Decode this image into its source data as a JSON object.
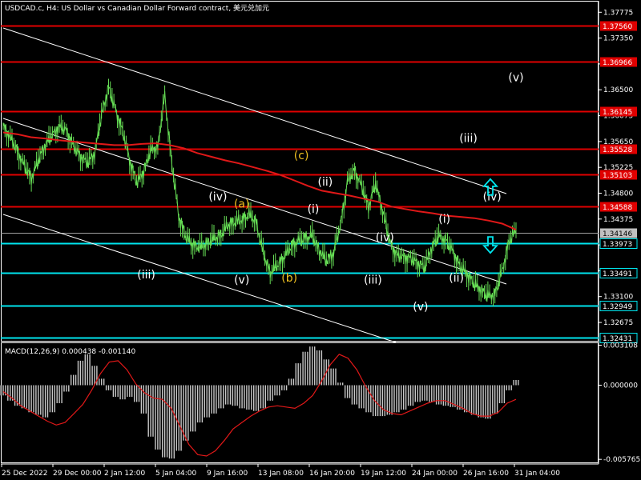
{
  "chart_title": "USDCAD.c, H4:  US Dollar vs Canadian Dollar Forward contract, 美元兑加元",
  "colors": {
    "background": "#000000",
    "price_line": "#66dd55",
    "moving_average": "#e01818",
    "channel_lines": "#ffffff",
    "resistance_lines": "#e00000",
    "support_lines": "#00e5ee",
    "arrows": "#00e5ee",
    "wave_labels_white": "#ffffff",
    "wave_labels_orange": "#f0c020",
    "macd_histogram": "#c8c8c8",
    "macd_signal": "#e01818",
    "axis": "#ffffff"
  },
  "chart_data": [
    {
      "type": "line",
      "name": "USDCAD.c H4 price",
      "x_labels": [
        "25 Dec 2022",
        "29 Dec 00:00",
        "2 Jan 12:00",
        "5 Jan 04:00",
        "9 Jan 16:00",
        "13 Jan 08:00",
        "16 Jan 20:00",
        "19 Jan 12:00",
        "24 Jan 00:00",
        "26 Jan 16:00",
        "31 Jan 04:00"
      ],
      "y_ticks": [
        "1.37775",
        "1.37350",
        "1.36925",
        "1.36500",
        "1.36075",
        "1.35650",
        "1.35225",
        "1.34800",
        "1.34375",
        "1.33950",
        "1.33525",
        "1.33100",
        "1.32675"
      ],
      "ylim": [
        1.3236,
        1.3795
      ],
      "series": [
        {
          "role": "price",
          "style": "bars",
          "values": [
            1.359,
            1.3572,
            1.355,
            1.3525,
            1.3505,
            1.3534,
            1.356,
            1.3576,
            1.359,
            1.3583,
            1.3557,
            1.3541,
            1.353,
            1.3545,
            1.3608,
            1.3655,
            1.3616,
            1.3582,
            1.3534,
            1.3497,
            1.3516,
            1.3551,
            1.3556,
            1.3641,
            1.3529,
            1.3441,
            1.3408,
            1.3395,
            1.3391,
            1.3397,
            1.3406,
            1.3411,
            1.3428,
            1.3432,
            1.3436,
            1.3445,
            1.3433,
            1.3382,
            1.3349,
            1.3361,
            1.3375,
            1.3393,
            1.3401,
            1.3406,
            1.341,
            1.3386,
            1.3369,
            1.3381,
            1.3427,
            1.3499,
            1.3518,
            1.3492,
            1.3458,
            1.3496,
            1.3452,
            1.3401,
            1.3378,
            1.3375,
            1.3373,
            1.3365,
            1.3358,
            1.3391,
            1.341,
            1.3402,
            1.3385,
            1.3359,
            1.3348,
            1.3331,
            1.3321,
            1.3311,
            1.3314,
            1.3351,
            1.3401,
            1.3419
          ]
        },
        {
          "role": "moving_average",
          "style": "line",
          "values": [
            1.358,
            1.3577,
            1.3572,
            1.357,
            1.3567,
            1.3565,
            1.3563,
            1.3561,
            1.3559,
            1.3559,
            1.3561,
            1.3562,
            1.3559,
            1.3554,
            1.3546,
            1.354,
            1.3534,
            1.3529,
            1.3523,
            1.3517,
            1.351,
            1.3501,
            1.3492,
            1.3484,
            1.348,
            1.3476,
            1.3471,
            1.3466,
            1.3458,
            1.3454,
            1.345,
            1.3447,
            1.3443,
            1.3441,
            1.3439,
            1.3435,
            1.343,
            1.342
          ]
        }
      ],
      "levels": [
        {
          "label": "1.37560",
          "type": "resistance",
          "value": 1.3756
        },
        {
          "label": "1.36966",
          "type": "resistance",
          "value": 1.36966
        },
        {
          "label": "1.36145",
          "type": "resistance",
          "value": 1.36145
        },
        {
          "label": "1.35528",
          "type": "resistance",
          "value": 1.35528
        },
        {
          "label": "1.35103",
          "type": "resistance",
          "value": 1.35103
        },
        {
          "label": "1.34588",
          "type": "resistance",
          "value": 1.34588
        },
        {
          "label": "1.34146",
          "type": "current",
          "value": 1.34146
        },
        {
          "label": "1.33973",
          "type": "support",
          "value": 1.33973
        },
        {
          "label": "1.33491",
          "type": "support",
          "value": 1.33491
        },
        {
          "label": "1.32949",
          "type": "support",
          "value": 1.32949
        },
        {
          "label": "1.32431",
          "type": "support",
          "value": 1.32431
        }
      ],
      "annotations": [
        {
          "text": "(iii)",
          "color": "white",
          "x_index": 12,
          "value": 1.33464
        },
        {
          "text": "(iv)",
          "color": "white",
          "x_index": 18,
          "value": 1.34749
        },
        {
          "text": "(a)",
          "color": "orange",
          "x_index": 20,
          "value": 1.3463
        },
        {
          "text": "(v)",
          "color": "white",
          "x_index": 20,
          "value": 1.33378
        },
        {
          "text": "(b)",
          "color": "orange",
          "x_index": 24,
          "value": 1.33409
        },
        {
          "text": "(c)",
          "color": "orange",
          "x_index": 25,
          "value": 1.35425
        },
        {
          "text": "(ii)",
          "color": "white",
          "x_index": 27,
          "value": 1.3499
        },
        {
          "text": "(i)",
          "color": "white",
          "x_index": 26,
          "value": 1.34545
        },
        {
          "text": "(iv)",
          "color": "white",
          "x_index": 32,
          "value": 1.34075
        },
        {
          "text": "(iii)",
          "color": "white",
          "x_index": 31,
          "value": 1.33378
        },
        {
          "text": "(v)",
          "color": "white",
          "x_index": 35,
          "value": 1.32937
        },
        {
          "text": "(i)",
          "color": "white",
          "x_index": 37,
          "value": 1.3438
        },
        {
          "text": "(ii)",
          "color": "white",
          "x_index": 38,
          "value": 1.33409
        },
        {
          "text": "(iv)",
          "color": "white",
          "x_index": 41,
          "value": 1.34749
        },
        {
          "text": "(iii)",
          "color": "white",
          "x_index": 39,
          "value": 1.35705
        },
        {
          "text": "(v)",
          "color": "white",
          "x_index": 43,
          "value": 1.36705
        }
      ],
      "arrows": [
        {
          "direction": "up",
          "x_index": 38,
          "value": 1.349
        },
        {
          "direction": "down",
          "x_index": 38,
          "value": 1.3395
        }
      ]
    },
    {
      "type": "bar",
      "title": "MACD(12,26,9) 0.000438 -0.001140",
      "y_ticks": [
        "0.003108",
        "0.000000",
        "-0.005765"
      ],
      "ylim": [
        -0.006,
        0.0032
      ],
      "series": [
        {
          "role": "histogram",
          "values": [
            -0.0008,
            -0.0012,
            -0.0016,
            -0.0018,
            -0.0021,
            -0.0023,
            -0.0025,
            -0.0021,
            -0.0014,
            -0.0005,
            0.0008,
            0.0019,
            0.0024,
            0.0015,
            0.0005,
            -0.0004,
            -0.0009,
            -0.0011,
            -0.0009,
            -0.0013,
            -0.0022,
            -0.004,
            -0.005,
            -0.0056,
            -0.0057,
            -0.0051,
            -0.0043,
            -0.0036,
            -0.0029,
            -0.0025,
            -0.0022,
            -0.0018,
            -0.0015,
            -0.0016,
            -0.0018,
            -0.0019,
            -0.002,
            -0.0018,
            -0.0012,
            -0.0008,
            -0.0004,
            0.0005,
            0.0017,
            0.0026,
            0.003,
            0.0027,
            0.002,
            0.0013,
            0.0002,
            -0.001,
            -0.0015,
            -0.0018,
            -0.0021,
            -0.0024,
            -0.0024,
            -0.0023,
            -0.0021,
            -0.0019,
            -0.0016,
            -0.0013,
            -0.0012,
            -0.0013,
            -0.0015,
            -0.0016,
            -0.0017,
            -0.0019,
            -0.0021,
            -0.0023,
            -0.0025,
            -0.0026,
            -0.0022,
            -0.0014,
            -0.0004,
            0.0004
          ]
        },
        {
          "role": "signal",
          "values": [
            -0.0005,
            -0.001,
            -0.0016,
            -0.002,
            -0.0024,
            -0.0028,
            -0.0031,
            -0.0029,
            -0.0022,
            -0.0015,
            -0.0004,
            0.0009,
            0.0018,
            0.0019,
            0.0012,
            0.0001,
            -0.0006,
            -0.001,
            -0.0011,
            -0.0018,
            -0.0032,
            -0.0046,
            -0.0054,
            -0.0055,
            -0.0051,
            -0.0043,
            -0.0034,
            -0.0029,
            -0.0024,
            -0.002,
            -0.0017,
            -0.0016,
            -0.0017,
            -0.0018,
            -0.0014,
            -0.0008,
            0.0003,
            0.0016,
            0.0024,
            0.0021,
            0.0012,
            -0.0001,
            -0.0012,
            -0.0019,
            -0.0022,
            -0.0023,
            -0.002,
            -0.0017,
            -0.0014,
            -0.0012,
            -0.0012,
            -0.0015,
            -0.0018,
            -0.0022,
            -0.0024,
            -0.0024,
            -0.0021,
            -0.0014,
            -0.0011
          ]
        }
      ]
    }
  ]
}
